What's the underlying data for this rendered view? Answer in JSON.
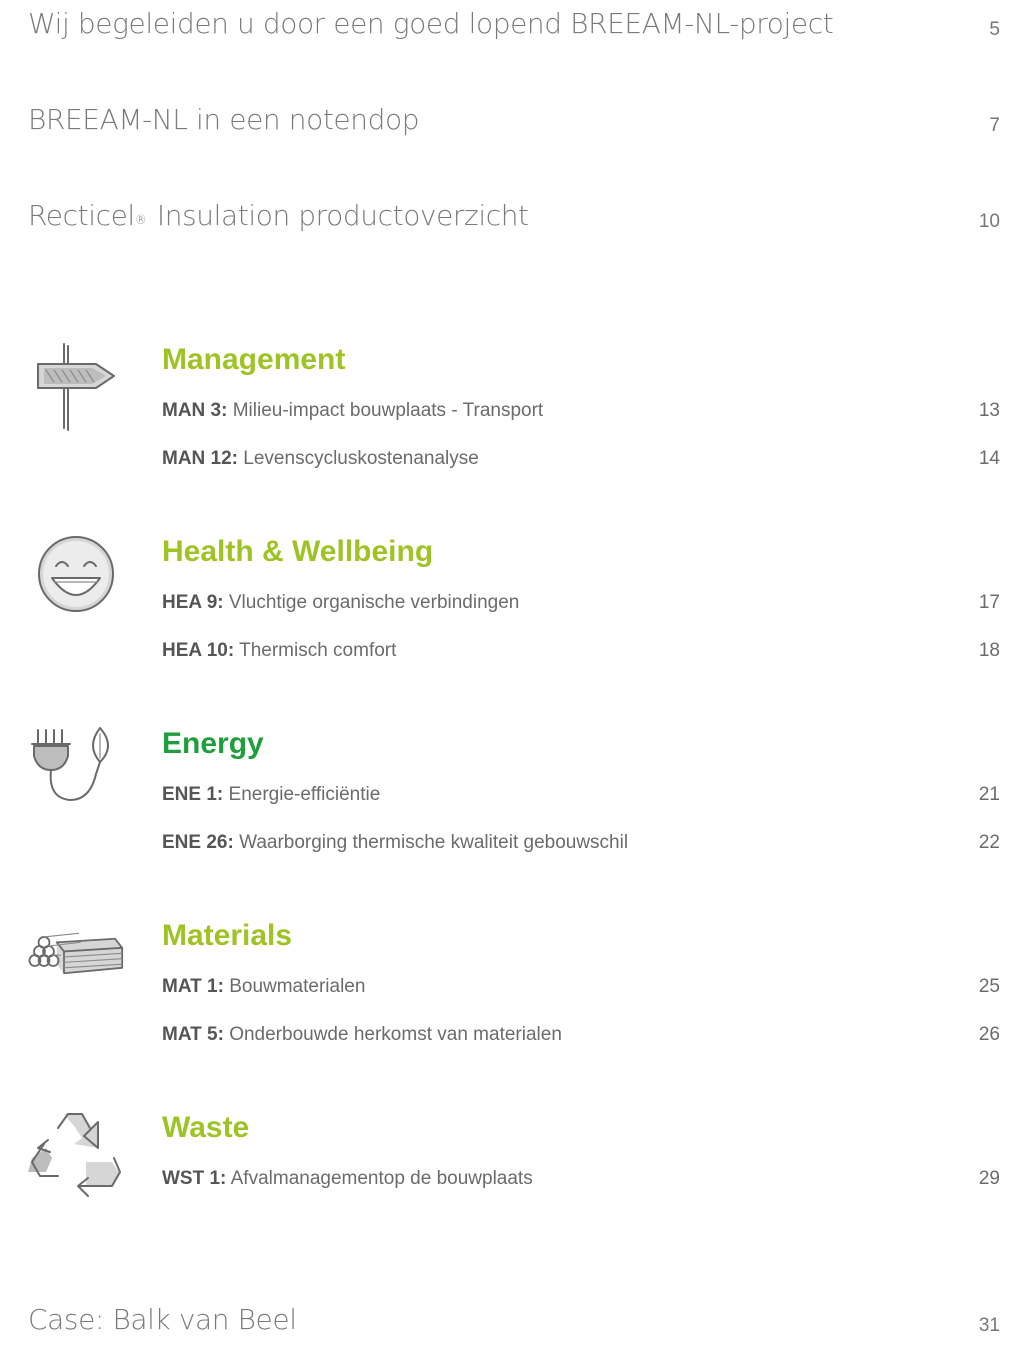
{
  "intro_items": [
    {
      "label": "Wij begeleiden u door een goed lopend BREEAM-NL-project",
      "page": "5"
    },
    {
      "label": "BREEAM-NL in een notendop",
      "page": "7"
    },
    {
      "label_pre": "Recticel",
      "label_sup": "®",
      "label_post": " Insulation productoverzicht",
      "page": "10"
    }
  ],
  "sections": [
    {
      "title": "Management",
      "icon": "signpost-icon",
      "entries": [
        {
          "code": "MAN 3:",
          "title": "Milieu-impact bouwplaats - Transport",
          "page": "13"
        },
        {
          "code": "MAN 12:",
          "title": "Levenscycluskostenanalyse",
          "page": "14"
        }
      ]
    },
    {
      "title": "Health & Wellbeing",
      "icon": "smiley-icon",
      "entries": [
        {
          "code": "HEA 9:",
          "title": "Vluchtige organische verbindingen",
          "page": "17"
        },
        {
          "code": "HEA 10:",
          "title": "Thermisch comfort",
          "page": "18"
        }
      ]
    },
    {
      "title": "Energy",
      "icon": "plug-leaf-icon",
      "color": "#1e9e3c",
      "entries": [
        {
          "code": "ENE 1:",
          "title": "Energie-efficiëntie",
          "page": "21"
        },
        {
          "code": "ENE 26:",
          "title": "Waarborging thermische kwaliteit gebouwschil",
          "page": "22"
        }
      ]
    },
    {
      "title": "Materials",
      "icon": "materials-stack-icon",
      "entries": [
        {
          "code": "MAT 1:",
          "title": "Bouwmaterialen",
          "page": "25"
        },
        {
          "code": "MAT 5:",
          "title": "Onderbouwde herkomst van materialen",
          "page": "26"
        }
      ]
    },
    {
      "title": "Waste",
      "icon": "recycle-icon",
      "entries": [
        {
          "code": "WST 1:",
          "title": "Afvalmanagementop de bouwplaats",
          "page": "29"
        }
      ]
    }
  ],
  "outro_items": [
    {
      "label": "Case: Balk van Beel",
      "page": "31"
    }
  ],
  "colors": {
    "section_heading": "#9dc324",
    "energy_heading": "#1e9e3c",
    "text": "#6b6b6b"
  }
}
